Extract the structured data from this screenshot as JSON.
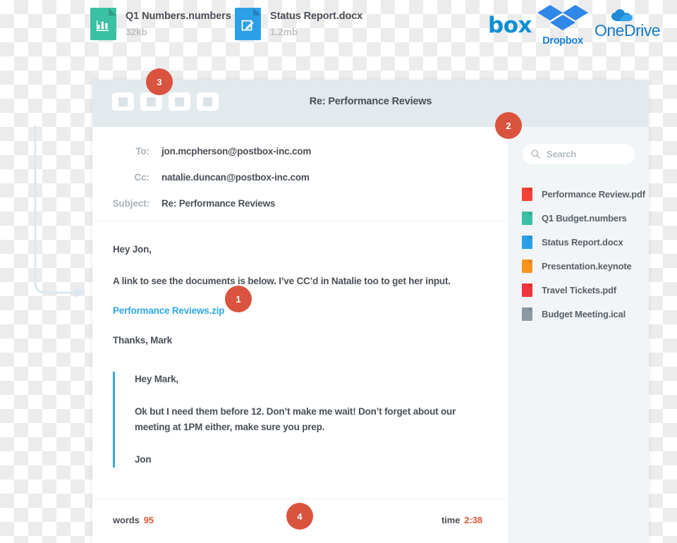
{
  "attachments_bar": {
    "items": [
      {
        "icon": "numbers-file-icon",
        "icon_color": "#3ac1a4",
        "name": "Q1 Numbers.numbers",
        "size": "32kb"
      },
      {
        "icon": "docx-file-icon",
        "icon_color": "#2ba0e8",
        "name": "Status Report.docx",
        "size": "1.2mb"
      }
    ],
    "cloud_services": [
      {
        "icon": "box-logo",
        "label": "box",
        "color": "#0b8fd4"
      },
      {
        "icon": "dropbox-logo",
        "label": "Dropbox",
        "color": "#1a7fdd"
      },
      {
        "icon": "onedrive-logo",
        "label": "OneDrive",
        "color": "#1878c8"
      }
    ]
  },
  "window": {
    "title": "Re: Performance Reviews",
    "toolbar": {
      "buttons": [
        {
          "name": "toolbar-button-1"
        },
        {
          "name": "toolbar-button-2"
        },
        {
          "name": "toolbar-button-3"
        },
        {
          "name": "toolbar-button-4"
        }
      ]
    }
  },
  "compose": {
    "fields": [
      {
        "label": "To:",
        "value": "jon.mcpherson@postbox-inc.com"
      },
      {
        "label": "Cc:",
        "value": "natalie.duncan@postbox-inc.com"
      },
      {
        "label": "Subject:",
        "value": "Re: Performance Reviews"
      }
    ],
    "body": {
      "greeting": "Hey Jon,",
      "paragraph": "A link to see the documents is below. I’ve CC’d in Natalie too to get her input.",
      "link_text": "Performance Reviews.zip",
      "link_color": "#2fa8e8",
      "signoff": "Thanks, Mark"
    },
    "quoted": {
      "greeting": "Hey Mark,",
      "paragraph": "Ok but I need them before 12. Don’t make me wait! Don’t forget about our meeting at 1PM either, make sure you prep.",
      "signature": "Jon",
      "accent_color": "#3ba8e0"
    }
  },
  "status_bar": {
    "words_label": "words",
    "words_value": "95",
    "time_label": "time",
    "time_value": "2:38",
    "value_color": "#e0553c"
  },
  "sidebar": {
    "search": {
      "icon": "search-icon",
      "placeholder": "Search",
      "value": ""
    },
    "files": [
      {
        "name": "Performance Review.pdf",
        "color": "#f44336"
      },
      {
        "name": "Q1 Budget.numbers",
        "color": "#3ac1a4"
      },
      {
        "name": "Status Report.docx",
        "color": "#2ba0e8"
      },
      {
        "name": "Presentation.keynote",
        "color": "#f79420"
      },
      {
        "name": "Travel Tickets.pdf",
        "color": "#f2353c"
      },
      {
        "name": "Budget Meeting.ical",
        "color": "#8d9aa3"
      }
    ]
  },
  "callouts": {
    "badge_color": "#d9533f",
    "items": [
      {
        "id": "badge-1",
        "label": "1"
      },
      {
        "id": "badge-2",
        "label": "2"
      },
      {
        "id": "badge-3",
        "label": "3"
      },
      {
        "id": "badge-4",
        "label": "4"
      }
    ]
  }
}
